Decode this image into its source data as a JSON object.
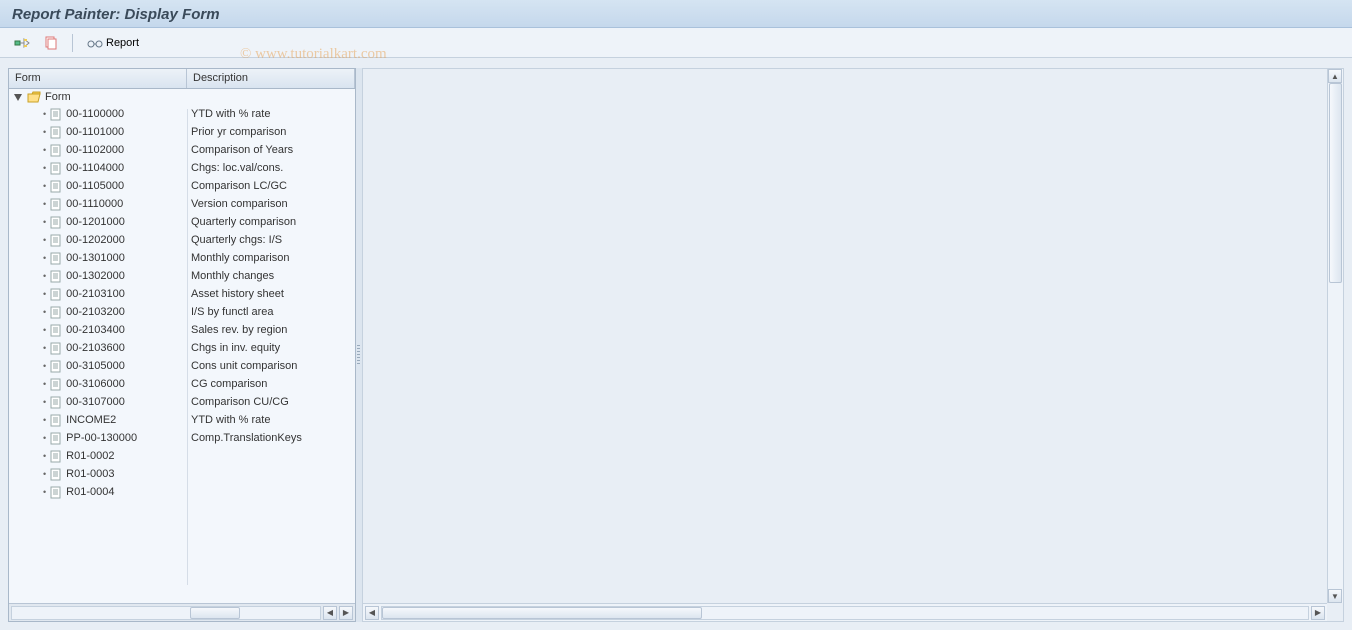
{
  "title": "Report Painter: Display Form",
  "toolbar": {
    "report_label": "Report"
  },
  "watermark": "© www.tutorialkart.com",
  "tree": {
    "header_form": "Form",
    "header_desc": "Description",
    "root_label": "Form",
    "items": [
      {
        "form": "00-1100000",
        "desc": "YTD with % rate"
      },
      {
        "form": "00-1101000",
        "desc": "Prior yr comparison"
      },
      {
        "form": "00-1102000",
        "desc": "Comparison of Years"
      },
      {
        "form": "00-1104000",
        "desc": "Chgs: loc.val/cons."
      },
      {
        "form": "00-1105000",
        "desc": "Comparison LC/GC"
      },
      {
        "form": "00-1110000",
        "desc": "Version comparison"
      },
      {
        "form": "00-1201000",
        "desc": "Quarterly comparison"
      },
      {
        "form": "00-1202000",
        "desc": "Quarterly chgs: I/S"
      },
      {
        "form": "00-1301000",
        "desc": "Monthly comparison"
      },
      {
        "form": "00-1302000",
        "desc": "Monthly changes"
      },
      {
        "form": "00-2103100",
        "desc": "Asset history sheet"
      },
      {
        "form": "00-2103200",
        "desc": "I/S by functl area"
      },
      {
        "form": "00-2103400",
        "desc": "Sales rev. by region"
      },
      {
        "form": "00-2103600",
        "desc": "Chgs in inv. equity"
      },
      {
        "form": "00-3105000",
        "desc": "Cons unit comparison"
      },
      {
        "form": "00-3106000",
        "desc": "CG comparison"
      },
      {
        "form": "00-3107000",
        "desc": "Comparison CU/CG"
      },
      {
        "form": "INCOME2",
        "desc": "YTD with % rate"
      },
      {
        "form": "PP-00-130000",
        "desc": "Comp.TranslationKeys"
      },
      {
        "form": "R01-0002",
        "desc": ""
      },
      {
        "form": "R01-0003",
        "desc": ""
      },
      {
        "form": "R01-0004",
        "desc": ""
      }
    ]
  }
}
